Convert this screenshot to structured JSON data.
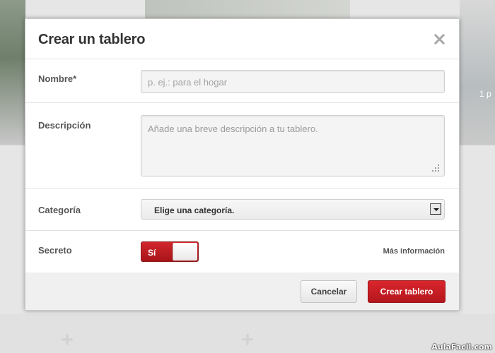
{
  "background": {
    "right_label": "1 p",
    "watermark": "AulaFacil.com"
  },
  "modal": {
    "title": "Crear un tablero",
    "close_icon": "close-icon",
    "fields": {
      "name": {
        "label": "Nombre*",
        "value": "",
        "placeholder": "p. ej.: para el hogar"
      },
      "description": {
        "label": "Descripción",
        "value": "",
        "placeholder": "Añade una breve descripción a tu tablero."
      },
      "category": {
        "label": "Categoría",
        "selected": "Elige una categoría."
      },
      "secret": {
        "label": "Secreto",
        "toggle_label": "Sí",
        "toggle_on": true,
        "more_info": "Más información"
      }
    },
    "footer": {
      "cancel_label": "Cancelar",
      "create_label": "Crear tablero"
    }
  },
  "colors": {
    "accent_red": "#cb2027",
    "text_dark": "#333333",
    "label_gray": "#555555"
  }
}
